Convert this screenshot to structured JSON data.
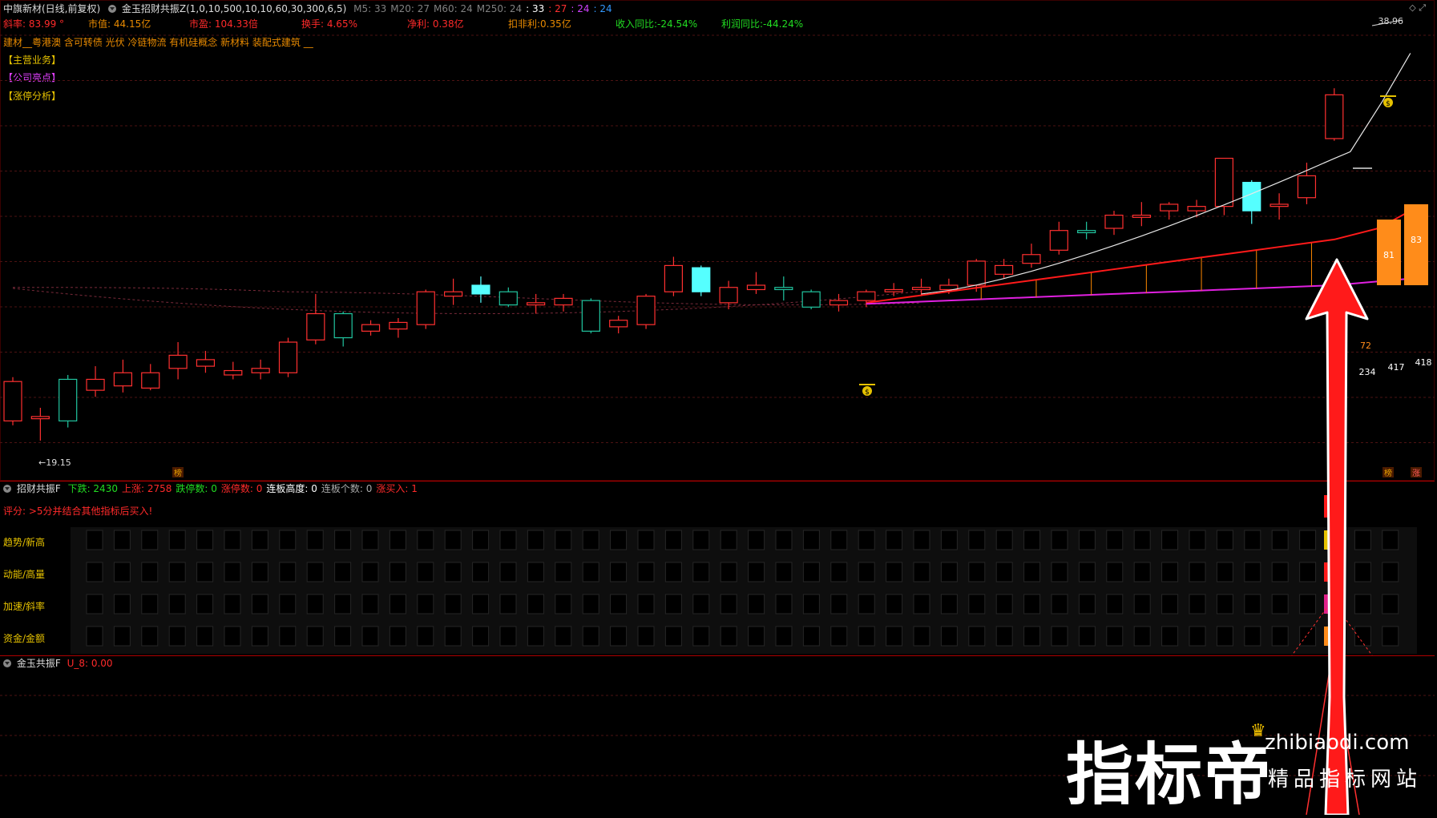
{
  "header": {
    "stock_title": "中旗新材(日线,前复权)",
    "indicator_formula": "金玉招财共振Z(1,0,10,500,10,10,60,30,300,6,5)",
    "ma_items": [
      {
        "label": "M5: 33",
        "color": "#808080"
      },
      {
        "label": "M20: 27",
        "color": "#808080"
      },
      {
        "label": "M60: 24",
        "color": "#808080"
      },
      {
        "label": "M250: 24",
        "color": "#808080"
      },
      {
        "label": ": 33",
        "color": "#ffffff"
      },
      {
        "label": ": 27",
        "color": "#ff3030"
      },
      {
        "label": ": 24",
        "color": "#d040ff"
      },
      {
        "label": ": 24",
        "color": "#3399ff"
      }
    ],
    "price_top_right": "38.96"
  },
  "fundamentals": [
    {
      "text": "斜率: 83.99 °",
      "color": "#ff2a2a"
    },
    {
      "text": "市值: 44.15亿",
      "color": "#e88a00"
    },
    {
      "text": "市盈: 104.33倍",
      "color": "#ff2a2a"
    },
    {
      "text": "换手: 4.65%",
      "color": "#ff2a2a"
    },
    {
      "text": "净利: 0.38亿",
      "color": "#ff2a2a"
    },
    {
      "text": "扣非利:0.35亿",
      "color": "#e88a00"
    },
    {
      "text": "收入同比:-24.54%",
      "color": "#22dd22"
    },
    {
      "text": "利润同比:-44.24%",
      "color": "#22dd22"
    }
  ],
  "concepts": "建材__粤港澳 含可转债 光伏 冷链物流 有机硅概念 新材料 装配式建筑 __",
  "info_tags": [
    {
      "text": "【主营业务】",
      "color": "#e6c200"
    },
    {
      "text": "【公司亮点】",
      "color": "#e040ff"
    },
    {
      "text": "【涨停分析】",
      "color": "#e6c200"
    }
  ],
  "chart_data": {
    "type": "candlestick",
    "low_label": "19.15",
    "high_label": "38.96",
    "right_bar_values": [
      "72",
      "81",
      "83"
    ],
    "right_line_values": [
      "234",
      "417",
      "418"
    ],
    "bottom_markers": [
      "榜",
      "榜",
      "涨"
    ],
    "candles": [
      {
        "o": 21.0,
        "c": 22.8,
        "h": 23.0,
        "l": 20.8
      },
      {
        "o": 21.1,
        "c": 21.2,
        "h": 21.6,
        "l": 20.1
      },
      {
        "o": 22.9,
        "c": 21.0,
        "h": 23.1,
        "l": 20.7
      },
      {
        "o": 22.4,
        "c": 22.9,
        "h": 23.5,
        "l": 22.1
      },
      {
        "o": 22.6,
        "c": 23.2,
        "h": 23.8,
        "l": 22.3
      },
      {
        "o": 22.5,
        "c": 23.2,
        "h": 23.6,
        "l": 22.4
      },
      {
        "o": 23.4,
        "c": 24.0,
        "h": 24.6,
        "l": 22.9
      },
      {
        "o": 23.5,
        "c": 23.8,
        "h": 24.2,
        "l": 23.2
      },
      {
        "o": 23.1,
        "c": 23.3,
        "h": 23.7,
        "l": 22.9
      },
      {
        "o": 23.2,
        "c": 23.4,
        "h": 23.8,
        "l": 22.9
      },
      {
        "o": 23.2,
        "c": 24.6,
        "h": 24.8,
        "l": 23.0
      },
      {
        "o": 24.7,
        "c": 25.9,
        "h": 26.8,
        "l": 24.5
      },
      {
        "o": 25.9,
        "c": 24.8,
        "h": 26.0,
        "l": 24.4
      },
      {
        "o": 25.1,
        "c": 25.4,
        "h": 25.6,
        "l": 24.9
      },
      {
        "o": 25.2,
        "c": 25.5,
        "h": 25.7,
        "l": 24.8
      },
      {
        "o": 25.4,
        "c": 26.9,
        "h": 27.0,
        "l": 25.2
      },
      {
        "o": 26.7,
        "c": 26.9,
        "h": 27.5,
        "l": 26.3
      },
      {
        "o": 26.8,
        "c": 27.2,
        "h": 27.6,
        "l": 26.4
      },
      {
        "o": 26.9,
        "c": 26.3,
        "h": 27.1,
        "l": 26.2
      },
      {
        "o": 26.3,
        "c": 26.4,
        "h": 26.8,
        "l": 25.9
      },
      {
        "o": 26.3,
        "c": 26.6,
        "h": 26.8,
        "l": 26.0
      },
      {
        "o": 26.5,
        "c": 25.1,
        "h": 26.6,
        "l": 25.0
      },
      {
        "o": 25.3,
        "c": 25.6,
        "h": 25.8,
        "l": 25.0
      },
      {
        "o": 25.4,
        "c": 26.7,
        "h": 26.8,
        "l": 25.2
      },
      {
        "o": 26.9,
        "c": 28.1,
        "h": 28.5,
        "l": 26.7
      },
      {
        "o": 28.0,
        "c": 26.9,
        "h": 28.1,
        "l": 26.7
      },
      {
        "o": 26.4,
        "c": 27.1,
        "h": 27.4,
        "l": 26.1
      },
      {
        "o": 27.0,
        "c": 27.2,
        "h": 27.8,
        "l": 26.8
      },
      {
        "o": 27.1,
        "c": 27.0,
        "h": 27.6,
        "l": 26.5
      },
      {
        "o": 26.9,
        "c": 26.2,
        "h": 27.0,
        "l": 26.1
      },
      {
        "o": 26.3,
        "c": 26.5,
        "h": 26.8,
        "l": 26.0
      },
      {
        "o": 26.5,
        "c": 26.9,
        "h": 27.0,
        "l": 26.2
      },
      {
        "o": 26.9,
        "c": 27.0,
        "h": 27.3,
        "l": 26.7
      },
      {
        "o": 27.0,
        "c": 27.1,
        "h": 27.5,
        "l": 26.7
      },
      {
        "o": 27.0,
        "c": 27.2,
        "h": 27.5,
        "l": 26.8
      },
      {
        "o": 27.2,
        "c": 28.3,
        "h": 28.4,
        "l": 26.9
      },
      {
        "o": 27.7,
        "c": 28.1,
        "h": 28.4,
        "l": 27.5
      },
      {
        "o": 28.2,
        "c": 28.6,
        "h": 29.1,
        "l": 28.0
      },
      {
        "o": 28.8,
        "c": 29.7,
        "h": 30.1,
        "l": 28.6
      },
      {
        "o": 29.7,
        "c": 29.6,
        "h": 30.1,
        "l": 29.3
      },
      {
        "o": 29.8,
        "c": 30.4,
        "h": 30.6,
        "l": 29.5
      },
      {
        "o": 30.3,
        "c": 30.4,
        "h": 31.0,
        "l": 29.9
      },
      {
        "o": 30.6,
        "c": 30.9,
        "h": 31.0,
        "l": 30.2
      },
      {
        "o": 30.6,
        "c": 30.8,
        "h": 31.1,
        "l": 30.3
      },
      {
        "o": 30.8,
        "c": 33.0,
        "h": 33.0,
        "l": 30.4
      },
      {
        "o": 31.9,
        "c": 30.6,
        "h": 32.0,
        "l": 30.0
      },
      {
        "o": 30.8,
        "c": 30.9,
        "h": 31.4,
        "l": 30.2
      },
      {
        "o": 31.2,
        "c": 32.2,
        "h": 32.8,
        "l": 30.9
      },
      {
        "o": 33.9,
        "c": 35.9,
        "h": 36.2,
        "l": 33.8
      }
    ]
  },
  "indicator_panel": {
    "title": "招财共振F",
    "stats": [
      {
        "text": "下跌: 2430",
        "color": "#22dd22"
      },
      {
        "text": "上涨: 2758",
        "color": "#ff2a2a"
      },
      {
        "text": "跌停数: 0",
        "color": "#22dd22"
      },
      {
        "text": "涨停数: 0",
        "color": "#ff2a2a"
      },
      {
        "text": "连板高度: 0",
        "color": "#ffffff"
      },
      {
        "text": "连板个数: 0",
        "color": "#aaaaaa"
      },
      {
        "text": "涨买入: 1",
        "color": "#ff2a2a"
      }
    ],
    "hint": "评分: >5分并结合其他指标后买入!",
    "rows": [
      "趋势/新高",
      "动能/高量",
      "加速/斜率",
      "资金/金额"
    ]
  },
  "bottom_panel": {
    "title": "金玉共振F",
    "value": "U_8: 0.00"
  },
  "watermark": {
    "main": "指标帝",
    "site": "zhibiaodi.com",
    "sub": "精品指标网站"
  }
}
